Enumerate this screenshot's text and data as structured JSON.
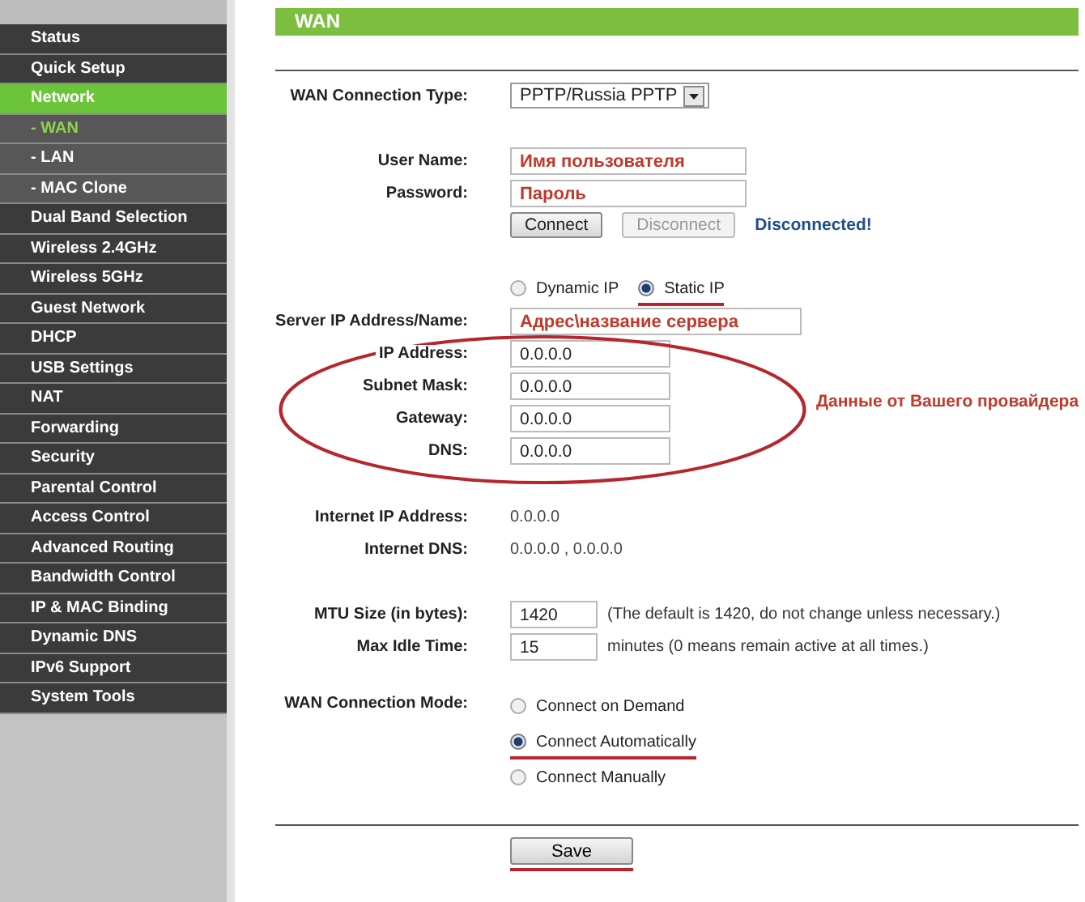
{
  "sidebar": {
    "items": [
      {
        "label": "Status",
        "kind": "section",
        "selected": false
      },
      {
        "label": "Quick Setup",
        "kind": "section",
        "selected": false
      },
      {
        "label": "Network",
        "kind": "section",
        "selected": true
      },
      {
        "label": "- WAN",
        "kind": "sub",
        "selected": true
      },
      {
        "label": "- LAN",
        "kind": "sub",
        "selected": false
      },
      {
        "label": "- MAC Clone",
        "kind": "sub",
        "selected": false
      },
      {
        "label": "Dual Band Selection",
        "kind": "section",
        "selected": false
      },
      {
        "label": "Wireless 2.4GHz",
        "kind": "section",
        "selected": false
      },
      {
        "label": "Wireless 5GHz",
        "kind": "section",
        "selected": false
      },
      {
        "label": "Guest Network",
        "kind": "section",
        "selected": false
      },
      {
        "label": "DHCP",
        "kind": "section",
        "selected": false
      },
      {
        "label": "USB Settings",
        "kind": "section",
        "selected": false
      },
      {
        "label": "NAT",
        "kind": "section",
        "selected": false
      },
      {
        "label": "Forwarding",
        "kind": "section",
        "selected": false
      },
      {
        "label": "Security",
        "kind": "section",
        "selected": false
      },
      {
        "label": "Parental Control",
        "kind": "section",
        "selected": false
      },
      {
        "label": "Access Control",
        "kind": "section",
        "selected": false
      },
      {
        "label": "Advanced Routing",
        "kind": "section",
        "selected": false
      },
      {
        "label": "Bandwidth Control",
        "kind": "section",
        "selected": false
      },
      {
        "label": "IP & MAC Binding",
        "kind": "section",
        "selected": false
      },
      {
        "label": "Dynamic DNS",
        "kind": "section",
        "selected": false
      },
      {
        "label": "IPv6 Support",
        "kind": "section",
        "selected": false
      },
      {
        "label": "System Tools",
        "kind": "section",
        "selected": false
      }
    ]
  },
  "page": {
    "title": "WAN",
    "connection_type": {
      "label": "WAN Connection Type:",
      "value": "PPTP/Russia PPTP"
    },
    "user_name": {
      "label": "User Name:",
      "value": "Имя пользователя"
    },
    "password": {
      "label": "Password:",
      "value": "Пароль"
    },
    "connect_button": {
      "label": "Connect",
      "disabled": false
    },
    "disconnect_button": {
      "label": "Disconnect",
      "disabled": true
    },
    "status": "Disconnected!",
    "ip_mode": [
      {
        "label": "Dynamic IP",
        "selected": false,
        "highlighted": false
      },
      {
        "label": "Static IP",
        "selected": true,
        "highlighted": true
      }
    ],
    "server": {
      "label": "Server IP Address/Name:",
      "value": "Адрес\\название сервера"
    },
    "static_fields": [
      {
        "label": "IP Address:",
        "value": "0.0.0.0"
      },
      {
        "label": "Subnet Mask:",
        "value": "0.0.0.0"
      },
      {
        "label": "Gateway:",
        "value": "0.0.0.0"
      },
      {
        "label": "DNS:",
        "value": "0.0.0.0"
      }
    ],
    "note": "Данные от Вашего провайдера",
    "internet_ip": {
      "label": "Internet IP Address:",
      "value": "0.0.0.0"
    },
    "internet_dns": {
      "label": "Internet DNS:",
      "value": "0.0.0.0 , 0.0.0.0"
    },
    "mtu": {
      "label": "MTU Size (in bytes):",
      "value": "1420",
      "hint": "(The default is 1420, do not change unless necessary.)"
    },
    "idle": {
      "label": "Max Idle Time:",
      "value": "15",
      "hint": "minutes (0 means remain active at all times.)"
    },
    "mode": {
      "label": "WAN Connection Mode:",
      "options": [
        {
          "label": "Connect on Demand",
          "selected": false,
          "highlighted": false
        },
        {
          "label": "Connect Automatically",
          "selected": true,
          "highlighted": true
        },
        {
          "label": "Connect Manually",
          "selected": false,
          "highlighted": false
        }
      ]
    },
    "save": {
      "label": "Save",
      "highlighted": true
    }
  }
}
